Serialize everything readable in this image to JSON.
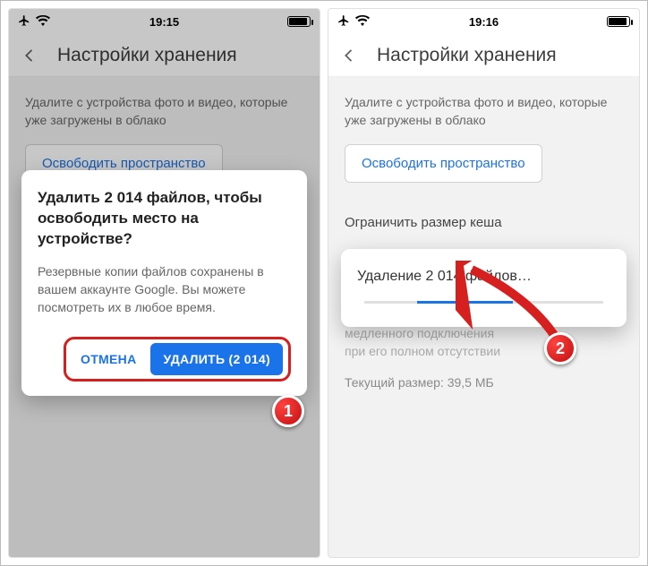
{
  "screen1": {
    "statusbar": {
      "time": "19:15"
    },
    "header": {
      "title": "Настройки хранения"
    },
    "body": {
      "desc": "Удалите с устройства фото и видео, которые уже загружены в облако",
      "free_space_button": "Освободить пространство"
    },
    "dialog": {
      "title": "Удалить 2 014 файлов, чтобы освободить место на устройстве?",
      "body": "Резервные копии файлов сохранены в вашем аккаунте Google. Вы можете посмотреть их в любое время.",
      "cancel": "ОТМЕНА",
      "confirm": "УДАЛИТЬ (2 014)"
    }
  },
  "screen2": {
    "statusbar": {
      "time": "19:16"
    },
    "header": {
      "title": "Настройки хранения"
    },
    "body": {
      "desc": "Удалите с устройства фото и видео, которые уже загружены в облако",
      "free_space_button": "Освободить пространство",
      "cache_section": "Ограничить размер кеша",
      "cache_desc_line": "медленного подключения",
      "cache_desc_line2": "при его полном отсутствии",
      "current_size_label": "Текущий размер: 39,5 МБ"
    },
    "progress_dialog": {
      "label": "Удаление 2 014 файлов…"
    }
  },
  "markers": {
    "m1": "1",
    "m2": "2"
  }
}
